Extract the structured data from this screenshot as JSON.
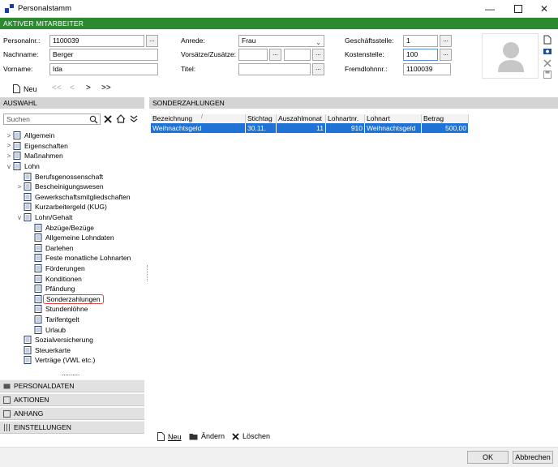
{
  "window": {
    "title": "Personalstamm"
  },
  "header": {
    "label": "AKTIVER MITARBEITER"
  },
  "form": {
    "personalnr_label": "Personalnr.:",
    "personalnr_value": "1100039",
    "nachname_label": "Nachname:",
    "nachname_value": "Berger",
    "vorname_label": "Vorname:",
    "vorname_value": "Ida",
    "anrede_label": "Anrede:",
    "anrede_value": "Frau",
    "vorsaetze_label": "Vorsätze/Zusätze:",
    "vorsaetze_value1": "",
    "vorsaetze_value2": "",
    "titel_label": "Titel:",
    "titel_value": "",
    "geschaeftsstelle_label": "Geschäftsstelle:",
    "geschaeftsstelle_value": "1",
    "kostenstelle_label": "Kostenstelle:",
    "kostenstelle_value": "100",
    "fremdlohn_label": "Fremdlohnnr.:",
    "fremdlohn_value": "1100039",
    "dots": "..."
  },
  "toolbar": {
    "new_label": "Neu",
    "first": "<<",
    "prev": "<",
    "next": ">",
    "last": ">>"
  },
  "left": {
    "header": "AUSWAHL",
    "search_placeholder": "Suchen",
    "tree": [
      {
        "label": "Allgemein",
        "level": 0,
        "exp": ">"
      },
      {
        "label": "Eigenschaften",
        "level": 0,
        "exp": ">"
      },
      {
        "label": "Maßnahmen",
        "level": 0,
        "exp": ">"
      },
      {
        "label": "Lohn",
        "level": 0,
        "exp": "v"
      },
      {
        "label": "Berufsgenossenschaft",
        "level": 1,
        "exp": ""
      },
      {
        "label": "Bescheinigungswesen",
        "level": 1,
        "exp": ">"
      },
      {
        "label": "Gewerkschaftsmitgliedschaften",
        "level": 1,
        "exp": ""
      },
      {
        "label": "Kurzarbeitergeld (KUG)",
        "level": 1,
        "exp": ""
      },
      {
        "label": "Lohn/Gehalt",
        "level": 1,
        "exp": "v"
      },
      {
        "label": "Abzüge/Bezüge",
        "level": 2,
        "exp": ""
      },
      {
        "label": "Allgemeine Lohndaten",
        "level": 2,
        "exp": ""
      },
      {
        "label": "Darlehen",
        "level": 2,
        "exp": ""
      },
      {
        "label": "Feste monatliche Lohnarten",
        "level": 2,
        "exp": ""
      },
      {
        "label": "Förderungen",
        "level": 2,
        "exp": ""
      },
      {
        "label": "Konditionen",
        "level": 2,
        "exp": ""
      },
      {
        "label": "Pfändung",
        "level": 2,
        "exp": ""
      },
      {
        "label": "Sonderzahlungen",
        "level": 2,
        "exp": "",
        "selected": true
      },
      {
        "label": "Stundenlöhne",
        "level": 2,
        "exp": ""
      },
      {
        "label": "Tarifentgelt",
        "level": 2,
        "exp": ""
      },
      {
        "label": "Urlaub",
        "level": 2,
        "exp": ""
      },
      {
        "label": "Sozialversicherung",
        "level": 1,
        "exp": ""
      },
      {
        "label": "Steuerkarte",
        "level": 1,
        "exp": ""
      },
      {
        "label": "Verträge (VWL etc.)",
        "level": 1,
        "exp": ""
      }
    ],
    "more": "..........",
    "panels": [
      "PERSONALDATEN",
      "AKTIONEN",
      "ANHANG",
      "EINSTELLUNGEN"
    ]
  },
  "right": {
    "header": "SONDERZAHLUNGEN",
    "columns": [
      "Bezeichnung",
      "Stichtag",
      "Auszahlmonat",
      "Lohnartnr.",
      "Lohnart",
      "Betrag"
    ],
    "rows": [
      [
        "Weihnachtsgeld",
        "30.11.",
        "11",
        "910",
        "Weihnachtsgeld",
        "500,00"
      ]
    ],
    "btn_new": "Neu",
    "btn_edit": "Ändern",
    "btn_delete": "Löschen"
  },
  "footer": {
    "ok": "OK",
    "cancel": "Abbrechen"
  }
}
